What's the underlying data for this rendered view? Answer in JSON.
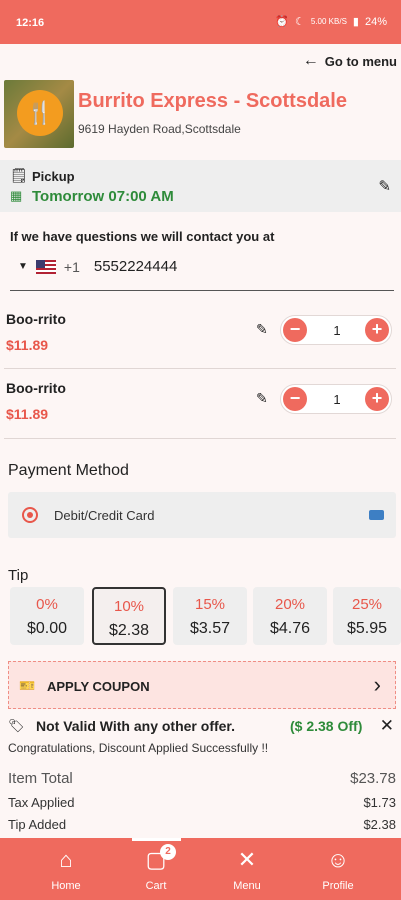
{
  "status_bar": {
    "time": "12:16",
    "battery": "24%",
    "net": "5.00 KB/S"
  },
  "nav": {
    "go_to_menu": "Go to menu"
  },
  "restaurant": {
    "name": "Burrito Express - Scottsdale",
    "address": "9619 Hayden Road,Scottsdale"
  },
  "pickup": {
    "label": "Pickup",
    "time": "Tomorrow 07:00 AM"
  },
  "contact": {
    "label": "If we have questions we will contact you at",
    "country_code": "+1",
    "phone": "5552224444"
  },
  "items": [
    {
      "name": "Boo-rrito",
      "price": "$11.89",
      "qty": "1"
    },
    {
      "name": "Boo-rrito",
      "price": "$11.89",
      "qty": "1"
    }
  ],
  "payment": {
    "title": "Payment Method",
    "method": "Debit/Credit Card"
  },
  "tip": {
    "title": "Tip",
    "options": [
      {
        "pct": "0%",
        "amount": "$0.00"
      },
      {
        "pct": "10%",
        "amount": "$2.38",
        "selected": true
      },
      {
        "pct": "15%",
        "amount": "$3.57"
      },
      {
        "pct": "20%",
        "amount": "$4.76"
      },
      {
        "pct": "25%",
        "amount": "$5.95"
      }
    ]
  },
  "coupon": {
    "label": "APPLY COUPON"
  },
  "offer": {
    "text": "Not Valid With any other offer.",
    "discount": "($ 2.38 Off)",
    "message": "Congratulations, Discount Applied Successfully !!"
  },
  "totals": {
    "item_total_label": "Item Total",
    "item_total": "$23.78",
    "tax_label": "Tax Applied",
    "tax": "$1.73",
    "tip_label": "Tip Added",
    "tip": "$2.38"
  },
  "bottom_nav": {
    "home": "Home",
    "cart": "Cart",
    "cart_badge": "2",
    "menu": "Menu",
    "profile": "Profile"
  },
  "colors": {
    "accent": "#ef6a5e",
    "success": "#2e8b3a"
  }
}
